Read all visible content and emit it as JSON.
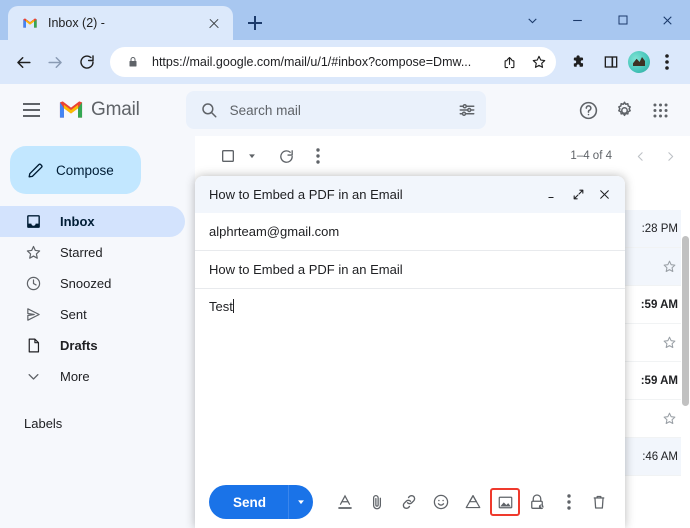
{
  "browser": {
    "tab": {
      "title": "Inbox (2) -",
      "favicon": "gmail-favicon",
      "close": "close-tab-icon"
    },
    "new_tab_label": "+",
    "window_controls": {
      "tab_search": "chevron-down-icon",
      "minimize": "minimize-icon",
      "maximize": "maximize-icon",
      "close": "close-icon"
    },
    "nav": {
      "back": "back-arrow-icon",
      "forward": "forward-arrow-icon",
      "reload": "reload-icon"
    },
    "omnibox": {
      "lock": "lock-icon",
      "url": "https://mail.google.com/mail/u/1/#inbox?compose=Dmw...",
      "share": "share-icon",
      "bookmark": "star-icon"
    },
    "toolbar_right": {
      "extensions": "puzzle-icon",
      "side_panel": "side-panel-icon",
      "profile": "profile-avatar",
      "menu": "three-dot-menu-icon"
    }
  },
  "gmail": {
    "header": {
      "menu": "hamburger-icon",
      "logo_text": "Gmail",
      "search_placeholder": "Search mail",
      "search_value": "",
      "search_icon": "search-icon",
      "filter_icon": "tune-icon",
      "help_icon": "help-icon",
      "settings_icon": "gear-icon",
      "apps_icon": "apps-grid-icon"
    },
    "sidebar": {
      "compose_label": "Compose",
      "compose_icon": "pencil-icon",
      "items": [
        {
          "label": "Inbox",
          "icon": "inbox-icon",
          "active": true,
          "bold": true
        },
        {
          "label": "Starred",
          "icon": "star-icon",
          "active": false,
          "bold": false
        },
        {
          "label": "Snoozed",
          "icon": "clock-icon",
          "active": false,
          "bold": false
        },
        {
          "label": "Sent",
          "icon": "send-icon",
          "active": false,
          "bold": false
        },
        {
          "label": "Drafts",
          "icon": "drafts-icon",
          "active": false,
          "bold": true
        },
        {
          "label": "More",
          "icon": "chevron-down-icon",
          "active": false,
          "bold": false
        }
      ],
      "labels_heading": "Labels"
    },
    "list_toolbar": {
      "select_checkbox": "checkbox-icon",
      "select_dropdown": "chevron-down-icon",
      "refresh": "refresh-icon",
      "more": "three-dot-menu-icon",
      "pager_count": "1–4 of 4",
      "prev": "chevron-left-icon",
      "next": "chevron-right-icon"
    },
    "mail_rows": [
      {
        "time": ":28 PM",
        "read": true,
        "star": "star-outline-icon"
      },
      {
        "time": ":59 AM",
        "read": false,
        "star": "star-outline-icon"
      },
      {
        "time": ":59 AM",
        "read": false,
        "star": "star-outline-icon"
      },
      {
        "time": ":46 AM",
        "read": true,
        "star": "star-outline-icon"
      }
    ]
  },
  "compose": {
    "title": "How to Embed a PDF in an Email",
    "window_controls": {
      "minimize": "minimize-icon",
      "popout": "popout-icon",
      "close": "close-icon"
    },
    "to_value": "alphrteam@gmail.com",
    "subject_value": "How to Embed a PDF in an Email",
    "body_value": "Test",
    "footer": {
      "send_label": "Send",
      "send_options_icon": "chevron-down-icon",
      "tools": [
        {
          "name": "formatting-options-icon",
          "highlighted": false
        },
        {
          "name": "attach-file-icon",
          "highlighted": false
        },
        {
          "name": "insert-link-icon",
          "highlighted": false
        },
        {
          "name": "insert-emoji-icon",
          "highlighted": false
        },
        {
          "name": "insert-drive-icon",
          "highlighted": false
        },
        {
          "name": "insert-photo-icon",
          "highlighted": true
        },
        {
          "name": "confidential-mode-icon",
          "highlighted": false
        },
        {
          "name": "more-options-icon",
          "highlighted": false
        }
      ],
      "discard_icon": "trash-icon"
    }
  },
  "colors": {
    "accent_blue": "#1a73e8",
    "highlight_red": "#ef3a2d",
    "compose_chip": "#c2e7ff",
    "nav_active": "#d3e3fd"
  }
}
